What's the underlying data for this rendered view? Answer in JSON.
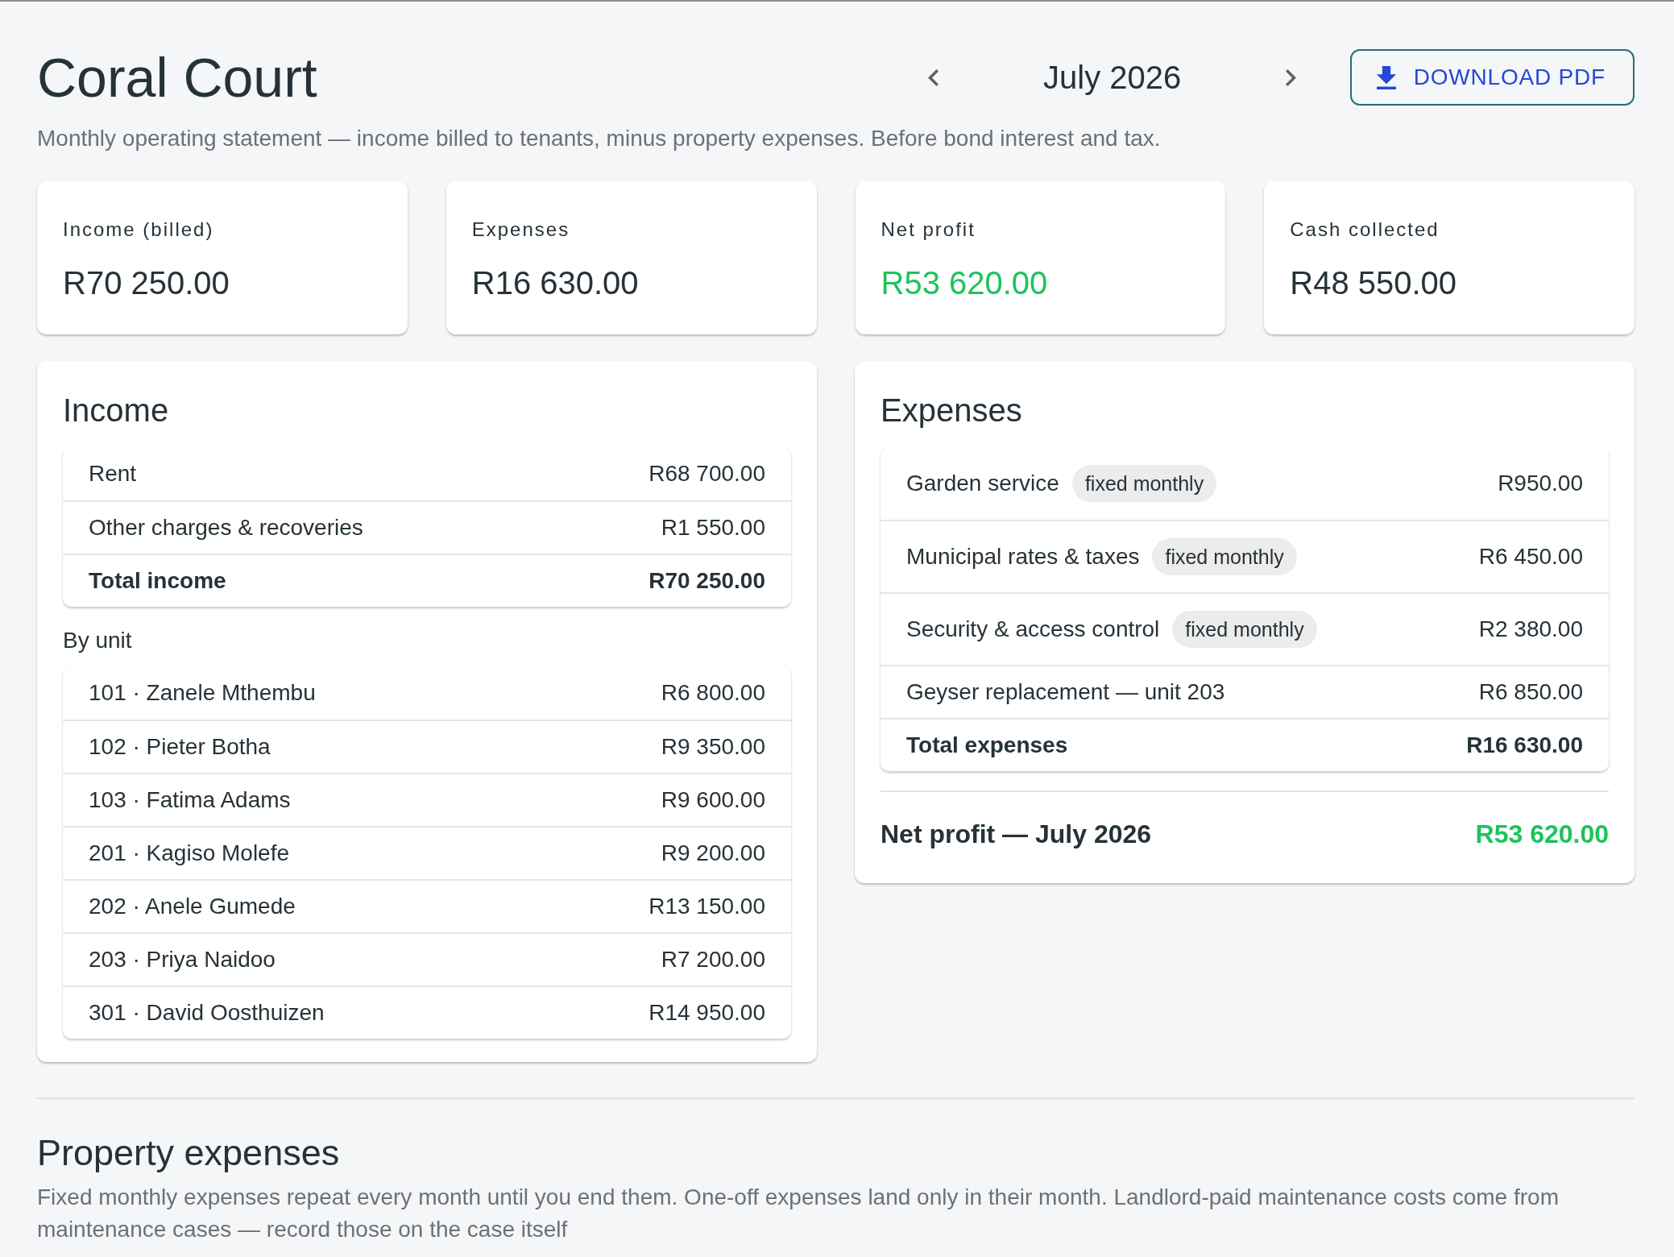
{
  "header": {
    "title": "Coral Court",
    "month": "July 2026",
    "download_button": "DOWNLOAD PDF",
    "subtitle": "Monthly operating statement — income billed to tenants, minus property expenses. Before bond interest and tax."
  },
  "summary_cards": [
    {
      "label": "Income (billed)",
      "value": "R70 250.00",
      "color": "#263238"
    },
    {
      "label": "Expenses",
      "value": "R16 630.00",
      "color": "#263238"
    },
    {
      "label": "Net profit",
      "value": "R53 620.00",
      "color": "#1bc45a"
    },
    {
      "label": "Cash collected",
      "value": "R48 550.00",
      "color": "#263238"
    }
  ],
  "income": {
    "title": "Income",
    "rows": [
      {
        "kind": "line",
        "label": "Rent",
        "amount": "R68 700.00"
      },
      {
        "kind": "line",
        "label": "Other charges & recoveries",
        "amount": "R1 550.00"
      },
      {
        "kind": "total",
        "label": "Total income",
        "amount": "R70 250.00"
      }
    ],
    "by_unit_label": "By unit",
    "units": [
      {
        "label": "101 · Zanele Mthembu",
        "amount": "R6 800.00"
      },
      {
        "label": "102 · Pieter Botha",
        "amount": "R9 350.00"
      },
      {
        "label": "103 · Fatima Adams",
        "amount": "R9 600.00"
      },
      {
        "label": "201 · Kagiso Molefe",
        "amount": "R9 200.00"
      },
      {
        "label": "202 · Anele Gumede",
        "amount": "R13 150.00"
      },
      {
        "label": "203 · Priya Naidoo",
        "amount": "R7 200.00"
      },
      {
        "label": "301 · David Oosthuizen",
        "amount": "R14 950.00"
      }
    ]
  },
  "expenses": {
    "title": "Expenses",
    "rows": [
      {
        "kind": "line",
        "label": "Garden service",
        "tag": "fixed monthly",
        "amount": "R950.00"
      },
      {
        "kind": "line",
        "label": "Municipal rates & taxes",
        "tag": "fixed monthly",
        "amount": "R6 450.00"
      },
      {
        "kind": "line",
        "label": "Security & access control",
        "tag": "fixed monthly",
        "amount": "R2 380.00"
      },
      {
        "kind": "line",
        "label": "Geyser replacement — unit 203",
        "amount": "R6 850.00"
      },
      {
        "kind": "total",
        "label": "Total expenses",
        "amount": "R16 630.00"
      }
    ],
    "net_profit": {
      "label": "Net profit — July 2026",
      "value": "R53 620.00",
      "positive": true
    }
  },
  "property_expenses": {
    "title": "Property expenses",
    "description": "Fixed monthly expenses repeat every month until you end them. One-off expenses land only in their month. Landlord-paid maintenance costs come from maintenance cases — record those on the case itself"
  }
}
